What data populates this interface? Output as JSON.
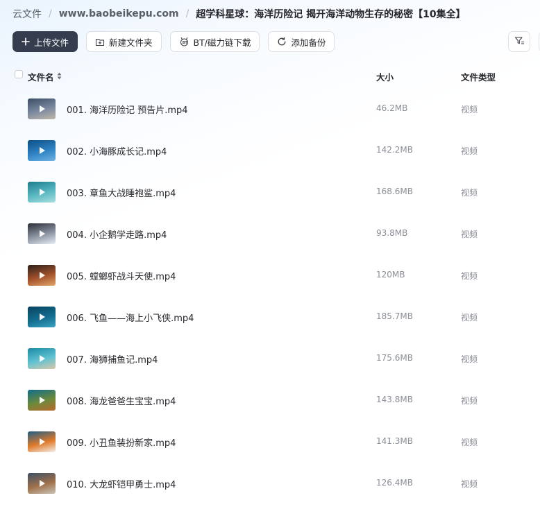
{
  "breadcrumb": {
    "root": "云文件",
    "site": "www.baobeikepu.com",
    "current": "超学科星球：海洋历险记 揭开海洋动物生存的秘密【10集全】"
  },
  "toolbar": {
    "upload_label": "上传文件",
    "new_folder_label": "新建文件夹",
    "bt_label": "BT/磁力链下载",
    "backup_label": "添加备份"
  },
  "table": {
    "headers": {
      "name": "文件名",
      "size": "大小",
      "type": "文件类型"
    },
    "rows": [
      {
        "name": "001. 海洋历险记 预告片.mp4",
        "size": "46.2MB",
        "type": "视频",
        "thumb_colors": [
          "#3a4f66",
          "#7c8aa0",
          "#c2b8a8"
        ]
      },
      {
        "name": "002. 小海豚成长记.mp4",
        "size": "142.2MB",
        "type": "视频",
        "thumb_colors": [
          "#0d4f86",
          "#2f83c4",
          "#6fb3e3"
        ]
      },
      {
        "name": "003. 章鱼大战睡袍鲨.mp4",
        "size": "168.6MB",
        "type": "视频",
        "thumb_colors": [
          "#1c7d8e",
          "#5bb9c2",
          "#a8dfe0"
        ]
      },
      {
        "name": "004. 小企鹅学走路.mp4",
        "size": "93.8MB",
        "type": "视频",
        "thumb_colors": [
          "#2b2f38",
          "#8d95a4",
          "#e9eef4"
        ]
      },
      {
        "name": "005. 螳螂虾战斗天使.mp4",
        "size": "120MB",
        "type": "视频",
        "thumb_colors": [
          "#2a1f1a",
          "#a3522b",
          "#e3a56b"
        ]
      },
      {
        "name": "006. 飞鱼——海上小飞侠.mp4",
        "size": "185.7MB",
        "type": "视频",
        "thumb_colors": [
          "#08435f",
          "#136d8f",
          "#3aa3c4"
        ]
      },
      {
        "name": "007. 海狮捕鱼记.mp4",
        "size": "175.6MB",
        "type": "视频",
        "thumb_colors": [
          "#1a8aa3",
          "#62c3d3",
          "#d9c7a8"
        ]
      },
      {
        "name": "008. 海龙爸爸生宝宝.mp4",
        "size": "143.8MB",
        "type": "视频",
        "thumb_colors": [
          "#0f6c8a",
          "#6d8a3a",
          "#b86a2e"
        ]
      },
      {
        "name": "009. 小丑鱼装扮新家.mp4",
        "size": "141.3MB",
        "type": "视频",
        "thumb_colors": [
          "#1e5d86",
          "#e07a2a",
          "#f4f0ea"
        ]
      },
      {
        "name": "010. 大龙虾铠甲勇士.mp4",
        "size": "126.4MB",
        "type": "视频",
        "thumb_colors": [
          "#3c5166",
          "#a0704a",
          "#c9c4b8"
        ]
      }
    ]
  },
  "icons": {
    "upload": "plus-icon",
    "new_folder": "folder-plus-icon",
    "bt": "magnet-icon",
    "backup": "sync-icon",
    "filter": "filter-icon",
    "sort": "sort-icon",
    "play": "play-icon"
  }
}
